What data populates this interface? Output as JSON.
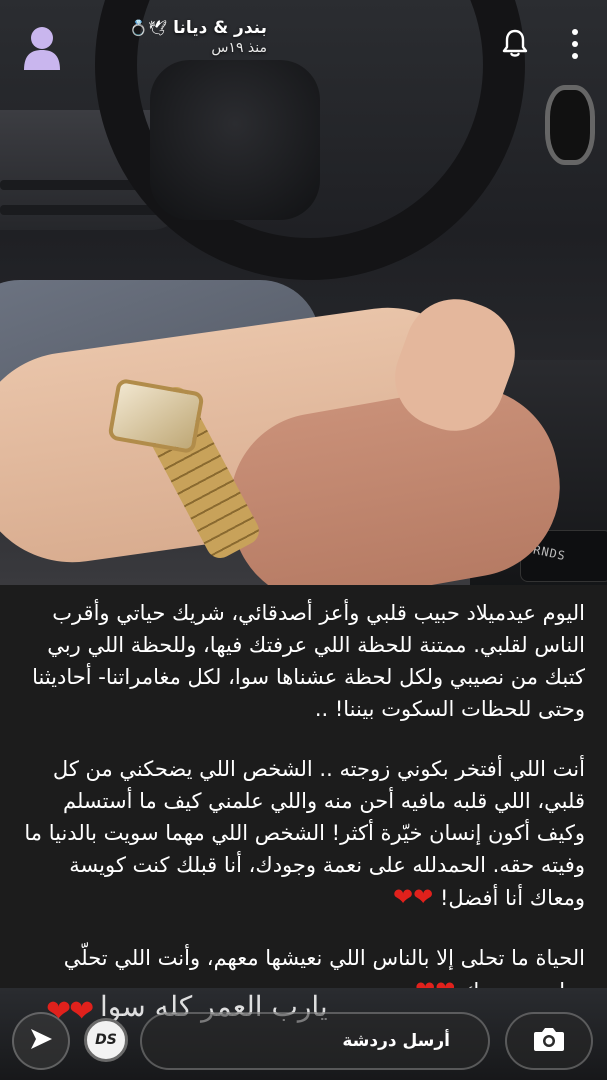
{
  "header": {
    "title": "بندر & ديانا",
    "title_emojis": "🕊💍",
    "subtitle": "منذ ١٩س",
    "avatar_icon": "avatar-icon",
    "bell_icon": "bell-icon",
    "more_icon": "more-vertical-icon"
  },
  "photo": {
    "gear_label": "PRNDS"
  },
  "caption": {
    "paragraph1": "اليوم عيدميلاد حبيب قلبي وأعز أصدقائي، شريك حياتي وأقرب الناس لقلبي. ممتنة للحظة اللي عرفتك فيها، وللحظة اللي ربي كتبك من نصيبي ولكل لحظة عشناها سوا، لكل مغامراتنا- أحاديثنا وحتى للحظات السكوت بيننا! ..",
    "paragraph2": "أنت اللي أفتخر بكوني زوجته .. الشخص اللي يضحكني من كل قلبي، اللي قلبه مافيه أحن منه واللي علمني كيف ما أستسلم وكيف أكون إنسان خيّرة أكثر! الشخص اللي مهما سويت بالدنيا ما وفيته حقه. الحمدلله على نعمة وجودك، أنا قبلك كنت كويسة ومعاك أنا أفضل!",
    "paragraph2_hearts": "❤❤",
    "paragraph3": "الحياة ما تحلى إلا بالناس اللي نعيشها معهم، وأنت اللي تحلّي حياتي بوجودك",
    "paragraph3_hearts": "❤❤"
  },
  "bottom_bar": {
    "overlay_text": "يارب العمر كله سوا",
    "overlay_hearts": "❤❤",
    "badge_text": "DS",
    "chat_placeholder": "أرسل دردشة",
    "send_icon": "send-arrow-icon",
    "camera_icon": "camera-icon"
  },
  "colors": {
    "caption_bg": "#1c1c1c",
    "heart_red": "#e0211c",
    "avatar_purple": "#c9b6ee"
  }
}
